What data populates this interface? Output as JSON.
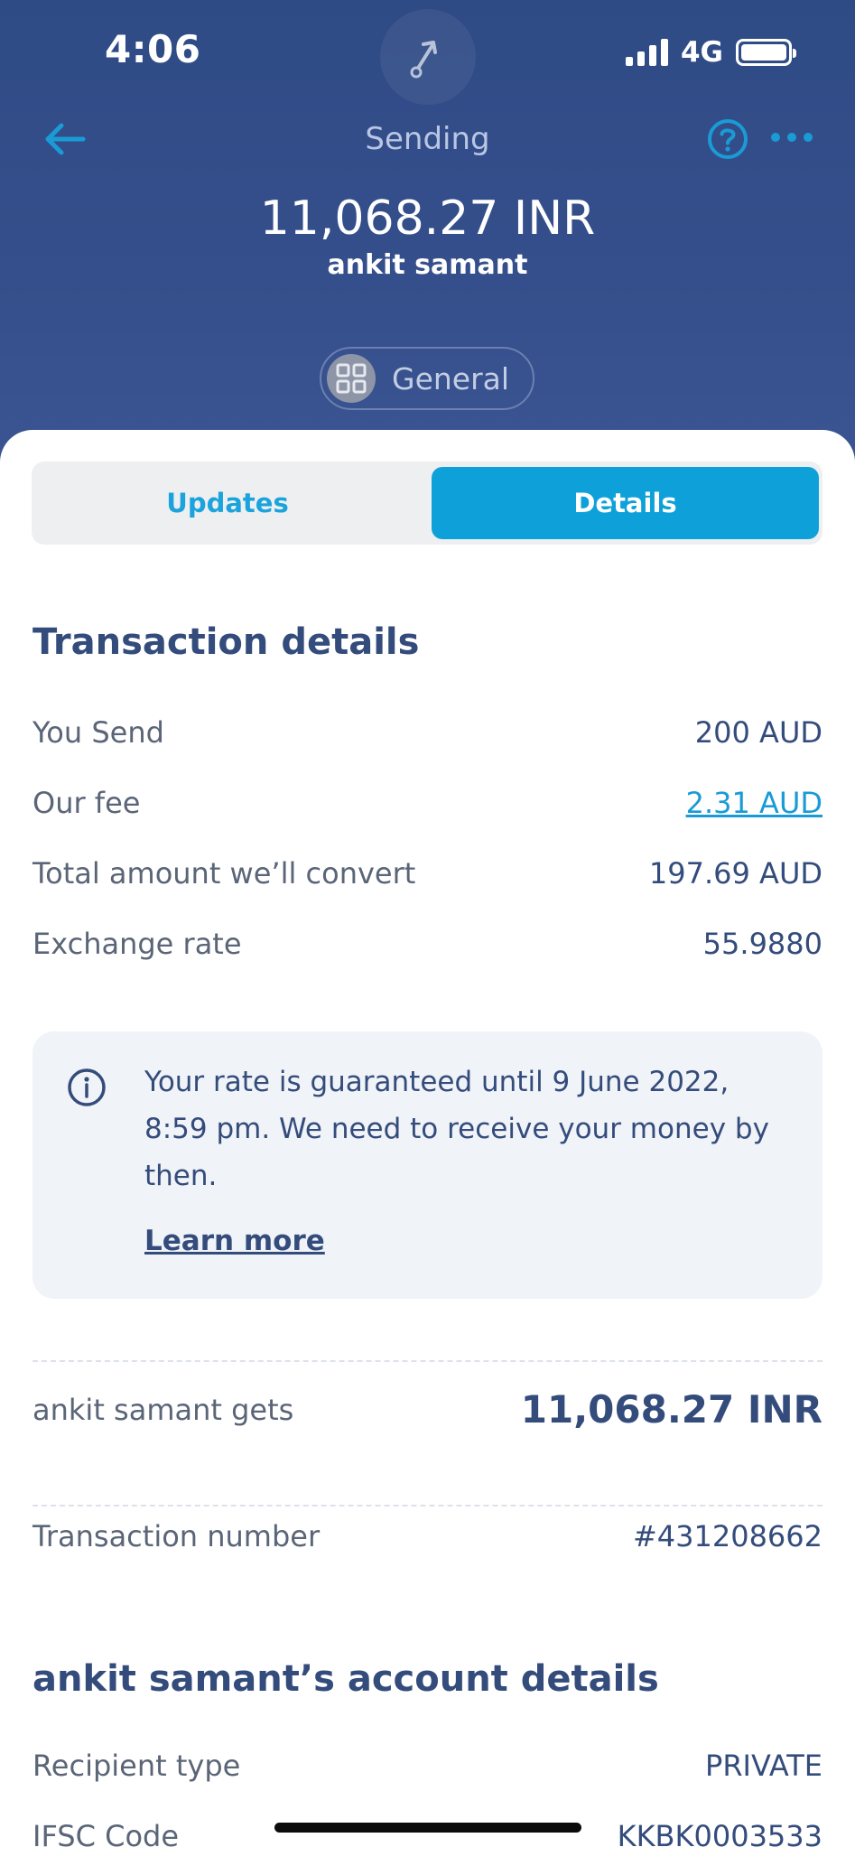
{
  "status_bar": {
    "time": "4:06",
    "network": "4G"
  },
  "header": {
    "title": "Sending",
    "amount": "11,068.27 INR",
    "recipient": "ankit samant",
    "category": "General"
  },
  "tabs": [
    {
      "label": "Updates",
      "active": false
    },
    {
      "label": "Details",
      "active": true
    }
  ],
  "transaction_details": {
    "title": "Transaction details",
    "rows": [
      {
        "label": "You Send",
        "value": "200 AUD"
      },
      {
        "label": "Our fee",
        "value": "2.31 AUD"
      },
      {
        "label": "Total amount we’ll convert",
        "value": "197.69 AUD"
      },
      {
        "label": "Exchange rate",
        "value": "55.9880"
      }
    ]
  },
  "info_box": {
    "text": "Your rate is guaranteed until 9 June 2022, 8:59 pm. We need to receive your money by then.",
    "link": "Learn more"
  },
  "recipient_gets": {
    "label": "ankit samant gets",
    "value": "11,068.27 INR"
  },
  "transaction_number": {
    "label": "Transaction number",
    "value": "#431208662"
  },
  "account_details": {
    "title": "ankit samant’s account details",
    "rows": [
      {
        "label": "Recipient type",
        "value": "PRIVATE"
      },
      {
        "label": "IFSC Code",
        "value": "KKBK0003533"
      }
    ]
  },
  "colors": {
    "header_bg": "#2f4b85",
    "accent": "#0ea1d9",
    "heading": "#344c7c",
    "muted_text": "#5a6577"
  }
}
